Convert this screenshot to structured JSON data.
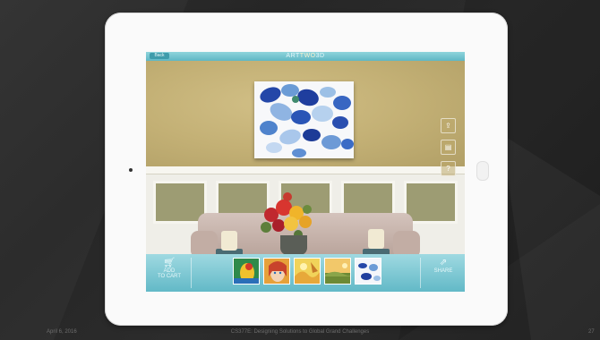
{
  "app": {
    "title_part1": "ART",
    "title_part2": "TWO",
    "title_part3": "3D",
    "back_label": "Back"
  },
  "toolbar": {
    "add_to_cart_label_line1": "ADD",
    "add_to_cart_label_line2": "TO CART",
    "share_label": "SHARE",
    "thumbnails": [
      "parrot",
      "woman-portrait",
      "yellow-abstract",
      "landscape",
      "blue-petals"
    ]
  },
  "side_tools": [
    "upload-icon",
    "tag-icon",
    "info-icon"
  ],
  "footer": {
    "date": "April 6, 2016",
    "course": "CS377E: Designing Solutions to Global Grand Challenges",
    "slide_number": "27"
  },
  "colors": {
    "accent": "#5fb7c4",
    "wall": "#c7b57a",
    "slide_bg": "#2a2a2a"
  }
}
